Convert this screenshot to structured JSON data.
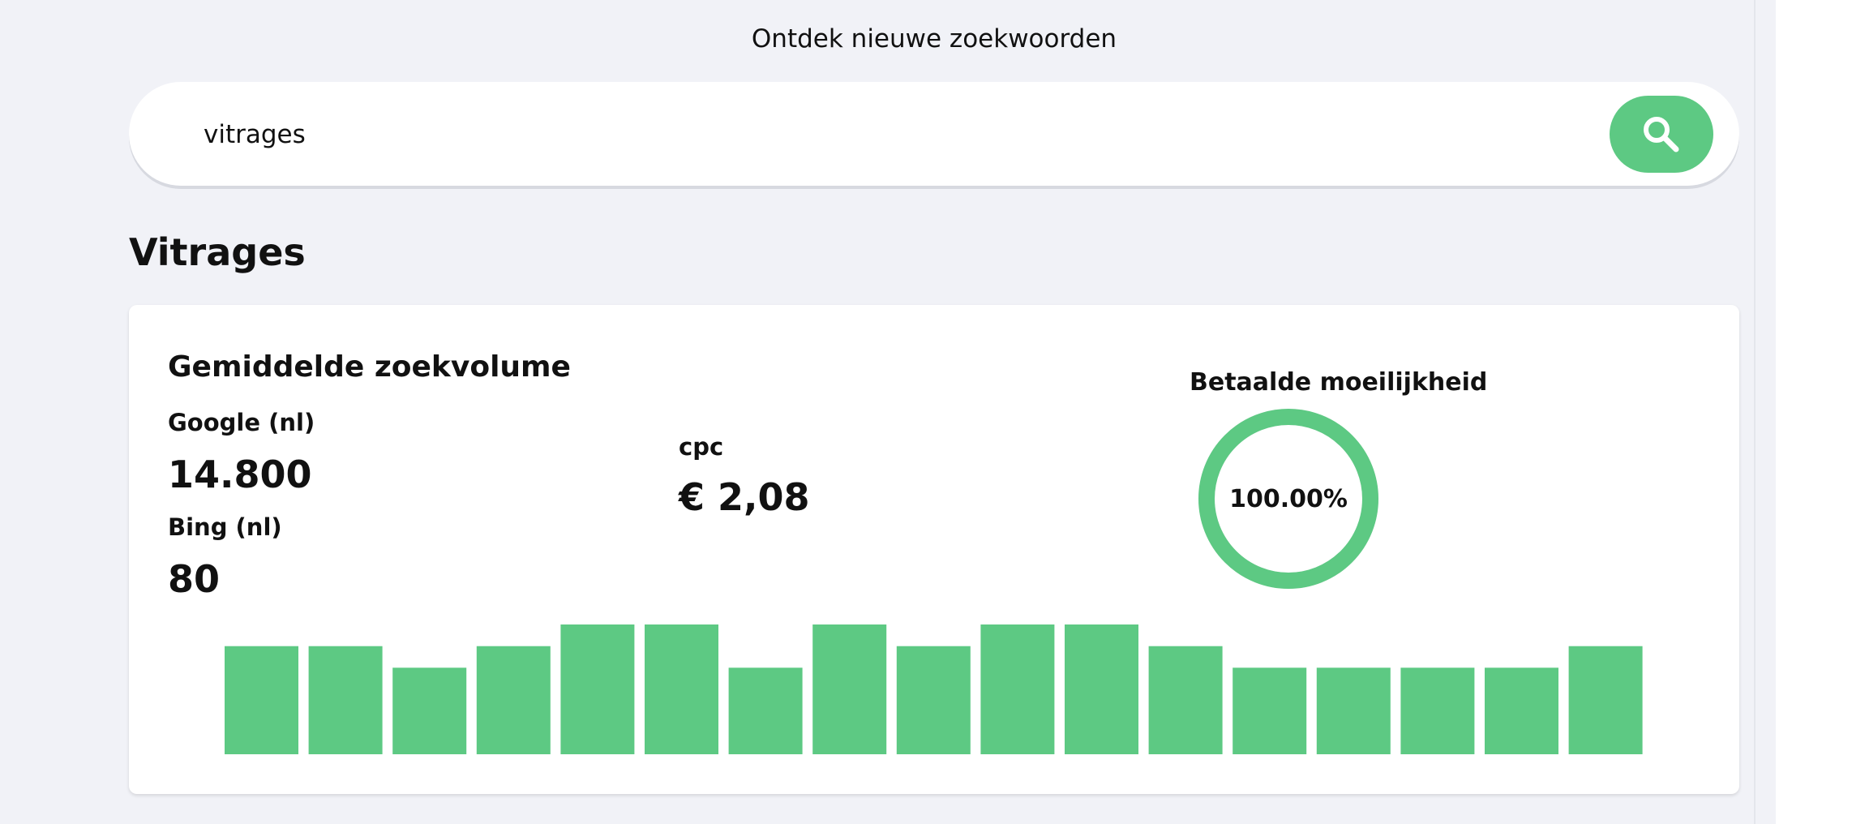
{
  "header": {
    "title": "Ontdek nieuwe zoekwoorden"
  },
  "search": {
    "value": "vitrages",
    "button_icon": "search-icon"
  },
  "keyword": {
    "title": "Vitrages"
  },
  "card": {
    "title": "Gemiddelde zoekvolume",
    "google_label": "Google (nl)",
    "google_value": "14.800",
    "bing_label": "Bing (nl)",
    "bing_value": "80",
    "cpc_label": "cpc",
    "cpc_value": "€ 2,08",
    "difficulty_label": "Betaalde moeilijkheid",
    "difficulty_value": "100.00%",
    "difficulty_fraction": 1.0
  },
  "colors": {
    "accent": "#5dc983",
    "background": "#f1f2f7",
    "card": "#ffffff"
  },
  "chart_data": {
    "type": "bar",
    "title": "",
    "xlabel": "",
    "ylabel": "",
    "grid": false,
    "values": [
      5,
      5,
      4,
      5,
      6,
      6,
      4,
      6,
      5,
      6,
      6,
      5,
      4,
      4,
      4,
      4,
      5
    ],
    "ylim": [
      0,
      6
    ]
  }
}
